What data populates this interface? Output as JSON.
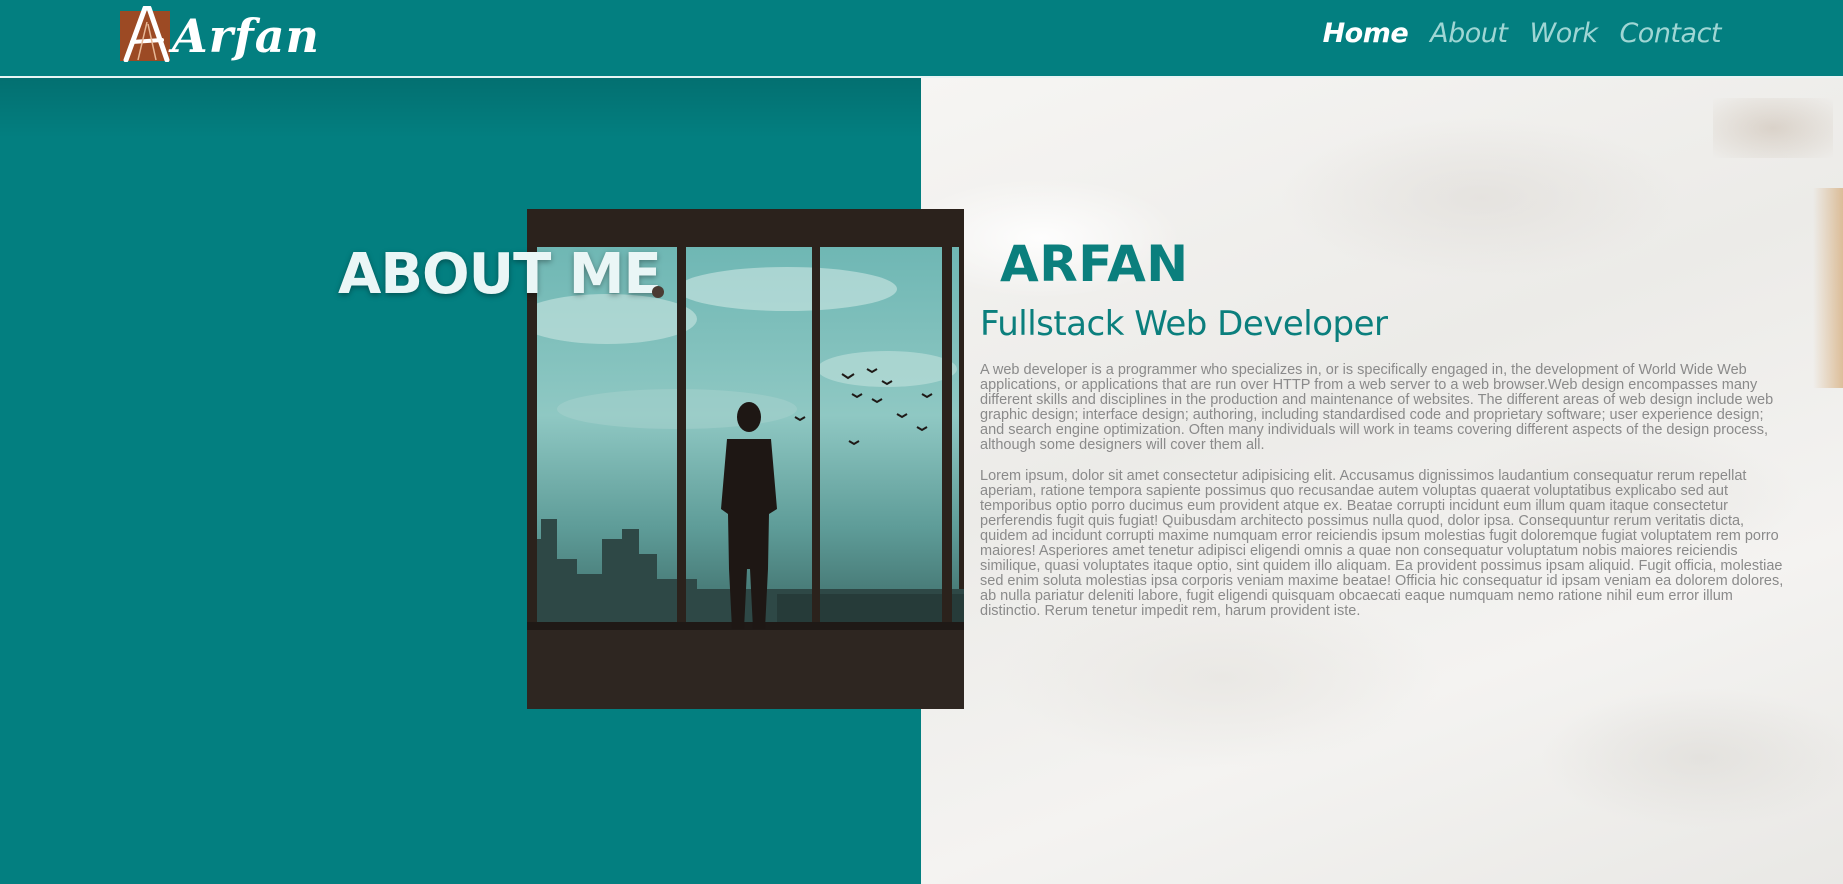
{
  "header": {
    "logo_text": "Arfan",
    "nav": [
      {
        "label": "Home",
        "active": true
      },
      {
        "label": "About",
        "active": false
      },
      {
        "label": "Work",
        "active": false
      },
      {
        "label": "Contact",
        "active": false
      }
    ]
  },
  "about": {
    "title": "ABOUT ME",
    "name": "ARFAN",
    "role": "Fullstack Web Developer",
    "paragraphs": [
      "A web developer is a programmer who specializes in, or is specifically engaged in, the development of World Wide Web applications, or applications that are run over HTTP from a web server to a web browser.Web design encompasses many different skills and disciplines in the production and maintenance of websites. The different areas of web design include web graphic design; interface design; authoring, including standardised code and proprietary software; user experience design; and search engine optimization. Often many individuals will work in teams covering different aspects of the design process, although some designers will cover them all.",
      "Lorem ipsum, dolor sit amet consectetur adipisicing elit. Accusamus dignissimos laudantium consequatur rerum repellat aperiam, ratione tempora sapiente possimus quo recusandae autem voluptas quaerat voluptatibus explicabo sed aut temporibus optio porro ducimus eum provident atque ex. Beatae corrupti incidunt eum illum quam itaque consectetur perferendis fugit quis fugiat! Quibusdam architecto possimus nulla quod, dolor ipsa. Consequuntur rerum veritatis dicta, quidem ad incidunt corrupti maxime numquam error reiciendis ipsum molestias fugit doloremque fugiat voluptatem rem porro maiores! Asperiores amet tenetur adipisci eligendi omnis a quae non consequatur voluptatum nobis maiores reiciendis similique, quasi voluptates itaque optio, sint quidem illo aliquam. Ea provident possimus ipsam aliquid. Fugit officia, molestiae sed enim soluta molestias ipsa corporis veniam maxime beatae! Officia hic consequatur id ipsam veniam ea dolorem dolores, ab nulla pariatur deleniti labore, fugit eligendi quisquam obcaecati eaque numquam nemo ratione nihil eum error illum distinctio. Rerum tenetur impedit rem, harum provident iste."
    ]
  },
  "colors": {
    "teal": "#037f80",
    "accent_text": "#0b7f7d",
    "body_text": "#8a8a8a",
    "logo_square": "#9c4a24"
  },
  "icons": {
    "logo": "stylized-letter-a-logo",
    "photo": "man-silhouette-window-photo"
  }
}
